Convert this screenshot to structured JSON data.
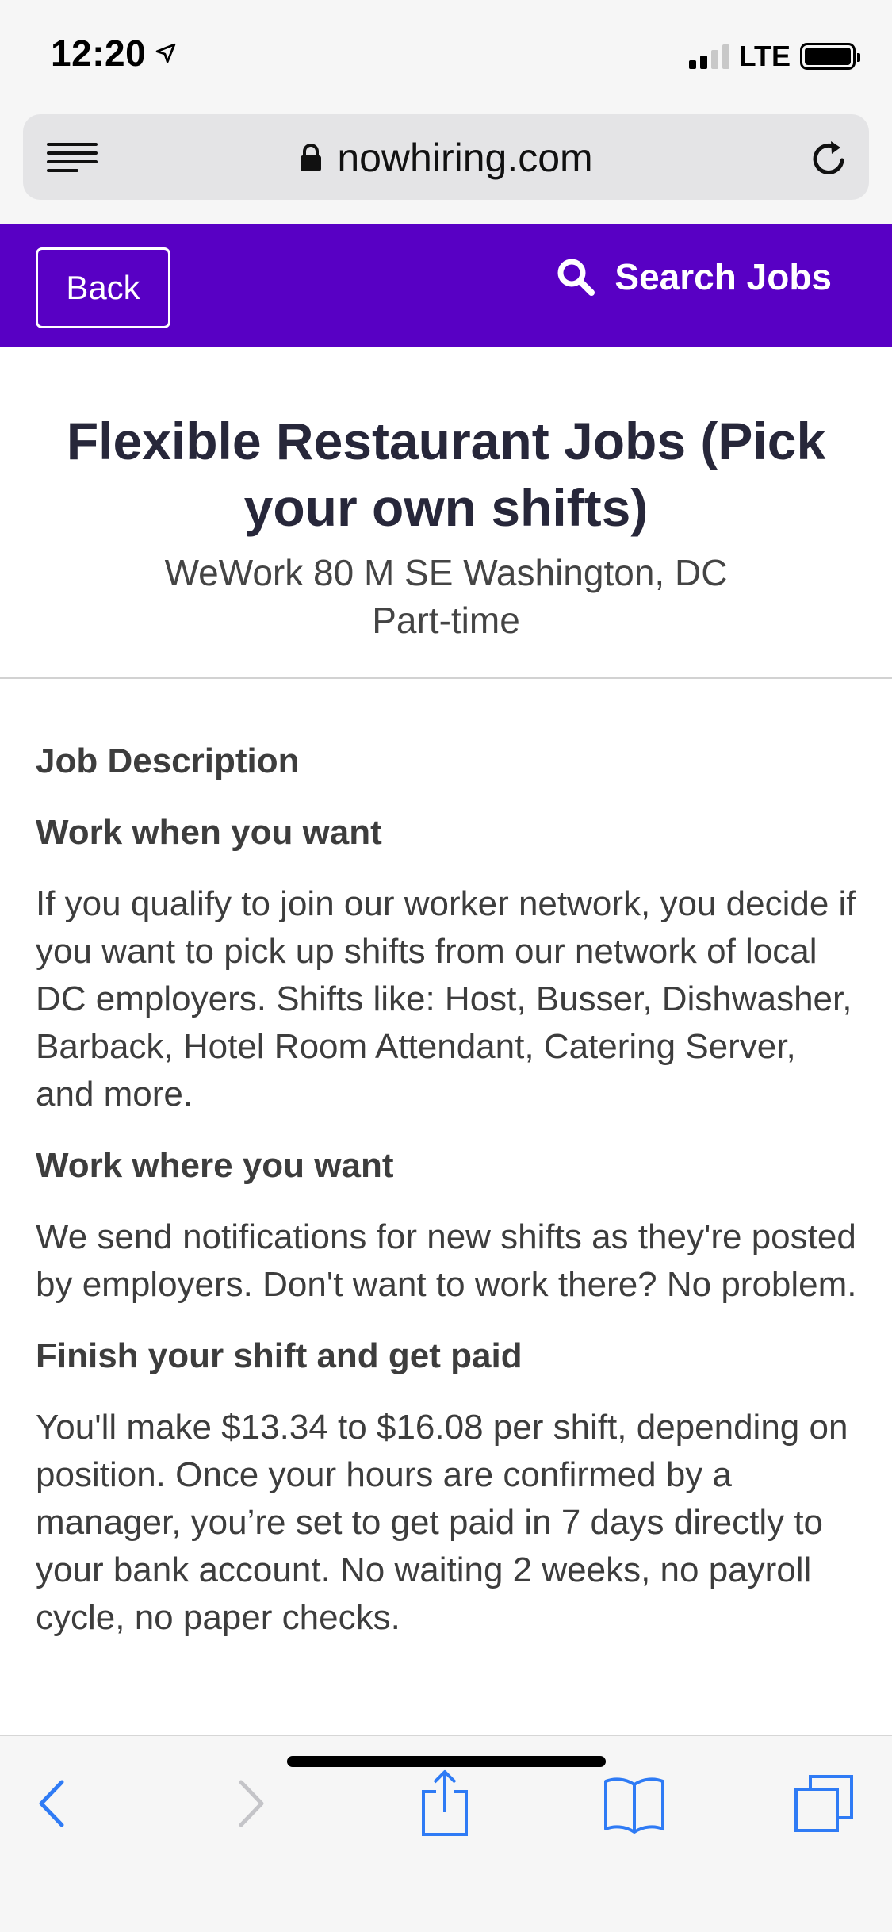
{
  "status_bar": {
    "time": "12:20",
    "network": "LTE",
    "icons": [
      "location-arrow-icon",
      "signal-icon",
      "battery-icon"
    ]
  },
  "browser": {
    "url": "nowhiring.com",
    "icons": [
      "reader-icon",
      "lock-icon",
      "reload-icon"
    ]
  },
  "header": {
    "back_label": "Back",
    "search_label": "Search Jobs",
    "background_color": "#5800c4"
  },
  "job": {
    "title": "Flexible Restaurant Jobs (Pick your own shifts)",
    "location": "WeWork 80 M SE Washington, DC",
    "type": "Part-time"
  },
  "description": {
    "heading": "Job Description",
    "sections": [
      {
        "heading": "Work when you want",
        "body": "If you qualify to join our worker network, you decide if you want to pick up shifts from our network of local DC employers. Shifts like: Host, Busser, Dishwasher, Barback, Hotel Room Attendant, Catering Server, and more."
      },
      {
        "heading": "Work where you want",
        "body": "We send notifications for new shifts as they're posted by employers. Don't want to work there? No problem."
      },
      {
        "heading": "Finish your shift and get paid",
        "body": "You'll make $13.34 to $16.08 per shift, depending on position. Once your hours are confirmed by a manager, you’re set to get paid in 7 days directly to your bank account. No waiting 2 weeks, no payroll cycle, no paper checks."
      }
    ]
  },
  "toolbar": {
    "icons": [
      "back-arrow-icon",
      "forward-arrow-icon",
      "share-icon",
      "bookmarks-icon",
      "tabs-icon"
    ],
    "accent_color": "#2f7bf5"
  }
}
